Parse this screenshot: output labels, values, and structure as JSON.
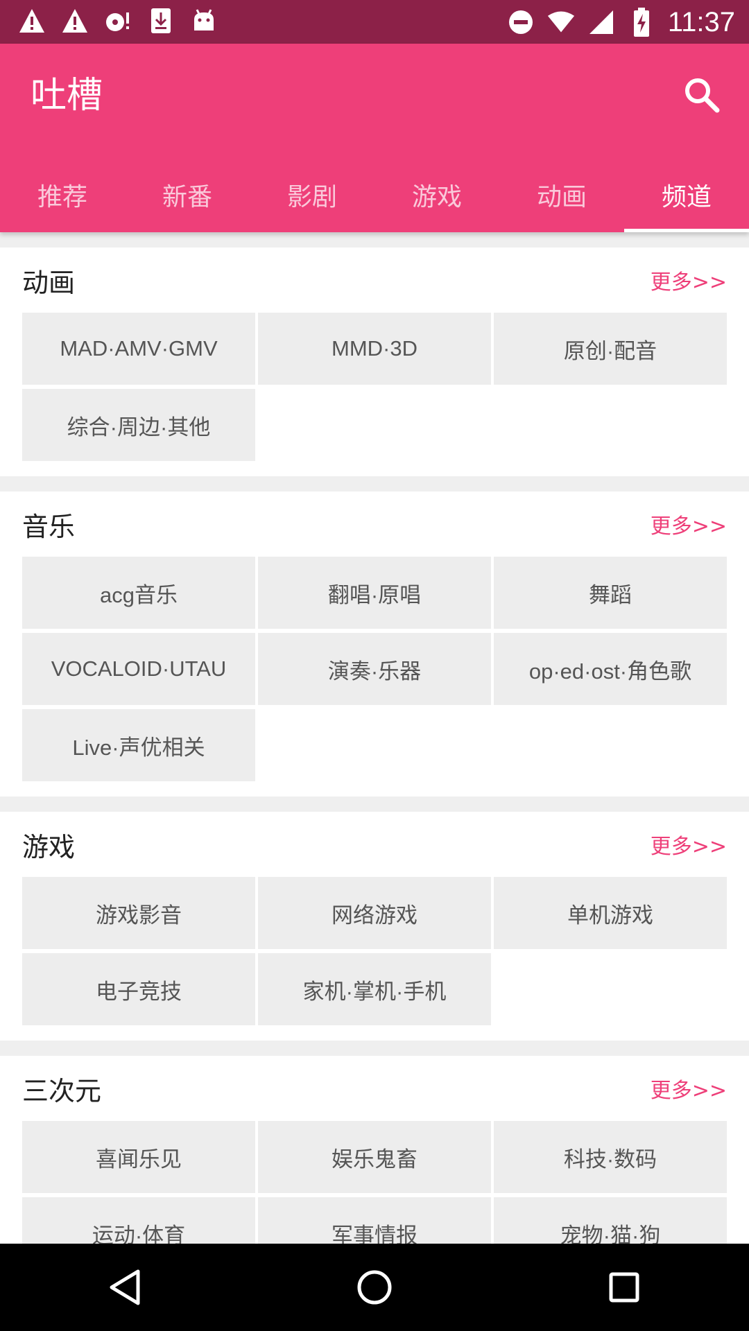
{
  "status_bar": {
    "time": "11:37",
    "left_icons": [
      "warning-icon",
      "warning-icon",
      "sd-card-alert-icon",
      "download-icon",
      "android-icon"
    ],
    "right_icons": [
      "do-not-disturb-icon",
      "wifi-icon",
      "signal-icon",
      "battery-charging-icon"
    ]
  },
  "app_bar": {
    "title": "吐槽",
    "search_icon": "search-icon",
    "color": "#ee3f79"
  },
  "tabs": [
    {
      "label": "推荐"
    },
    {
      "label": "新番"
    },
    {
      "label": "影剧"
    },
    {
      "label": "游戏"
    },
    {
      "label": "动画"
    },
    {
      "label": "频道"
    }
  ],
  "active_tab": "频道",
  "sections": [
    {
      "title": "动画",
      "more": "更多>>",
      "items": [
        "MAD·AMV·GMV",
        "MMD·3D",
        "原创·配音",
        "综合·周边·其他"
      ]
    },
    {
      "title": "音乐",
      "more": "更多>>",
      "items": [
        "acg音乐",
        "翻唱·原唱",
        "舞蹈",
        "VOCALOID·UTAU",
        "演奏·乐器",
        "op·ed·ost·角色歌",
        "Live·声优相关"
      ]
    },
    {
      "title": "游戏",
      "more": "更多>>",
      "items": [
        "游戏影音",
        "网络游戏",
        "单机游戏",
        "电子竞技",
        "家机·掌机·手机"
      ]
    },
    {
      "title": "三次元",
      "more": "更多>>",
      "items": [
        "喜闻乐见",
        "娱乐鬼畜",
        "科技·数码",
        "运动·体育",
        "军事情报",
        "宠物·猫·狗"
      ]
    }
  ],
  "nav_bar": {
    "buttons": [
      "back-icon",
      "home-icon",
      "recents-icon"
    ]
  }
}
